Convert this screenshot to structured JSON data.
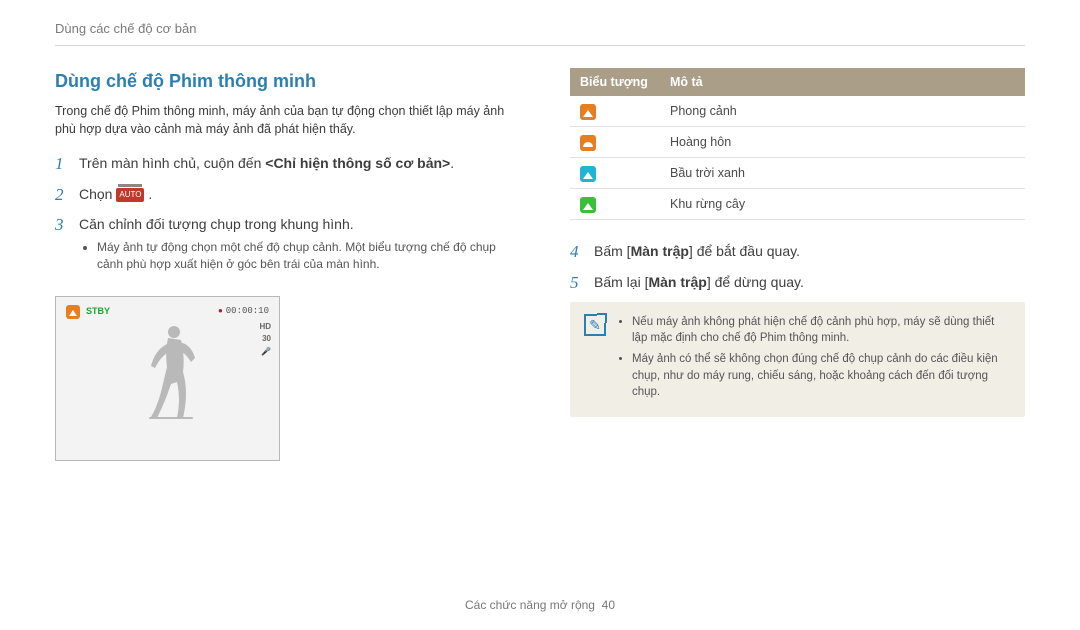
{
  "breadcrumb": "Dùng các chế độ cơ bản",
  "heading": "Dùng chế độ Phim thông minh",
  "intro": "Trong chế độ Phim thông minh, máy ảnh của bạn tự động chọn thiết lập máy ảnh phù hợp dựa vào cảnh mà máy ảnh đã phát hiện thấy.",
  "steps_left": {
    "s1_a": "Trên màn hình chủ, cuộn đến ",
    "s1_b": "<Chỉ hiện thông số cơ bản>",
    "s1_c": ".",
    "s2_a": "Chọn ",
    "s2_b": ".",
    "mode_icon_label": "AUTO",
    "s3": "Căn chỉnh đối tượng chụp trong khung hình.",
    "s3_sub": "Máy ảnh tự động chọn một chế độ chụp cảnh. Một biểu tượng chế độ chụp cảnh phù hợp xuất hiện ở góc bên trái của màn hình."
  },
  "camera": {
    "stby": "STBY",
    "timecode": "00:00:10",
    "hd": "HD",
    "r30": "30",
    "micoff": "✕"
  },
  "table": {
    "head_icon": "Biểu tượng",
    "head_desc": "Mô tả",
    "rows": [
      {
        "icon": "landscape",
        "label": "Phong cảnh"
      },
      {
        "icon": "sunset",
        "label": "Hoàng hôn"
      },
      {
        "icon": "sky",
        "label": "Bầu trời xanh"
      },
      {
        "icon": "forest",
        "label": "Khu rừng cây"
      }
    ]
  },
  "steps_right": {
    "s4_a": "Bấm [",
    "s4_b": "Màn trập",
    "s4_c": "] để bắt đầu quay.",
    "s5_a": "Bấm lại [",
    "s5_b": "Màn trập",
    "s5_c": "] để dừng quay."
  },
  "notes": {
    "n1": "Nếu máy ảnh không phát hiện chế độ cảnh phù hợp, máy sẽ dùng thiết lập mặc định cho chế độ Phim thông minh.",
    "n2": "Máy ảnh có thể sẽ không chọn đúng chế độ chụp cảnh do các điều kiện chụp, như do máy rung, chiếu sáng, hoặc khoảng cách đến đối tượng chụp."
  },
  "footer": {
    "section": "Các chức năng mở rộng",
    "page": "40"
  }
}
